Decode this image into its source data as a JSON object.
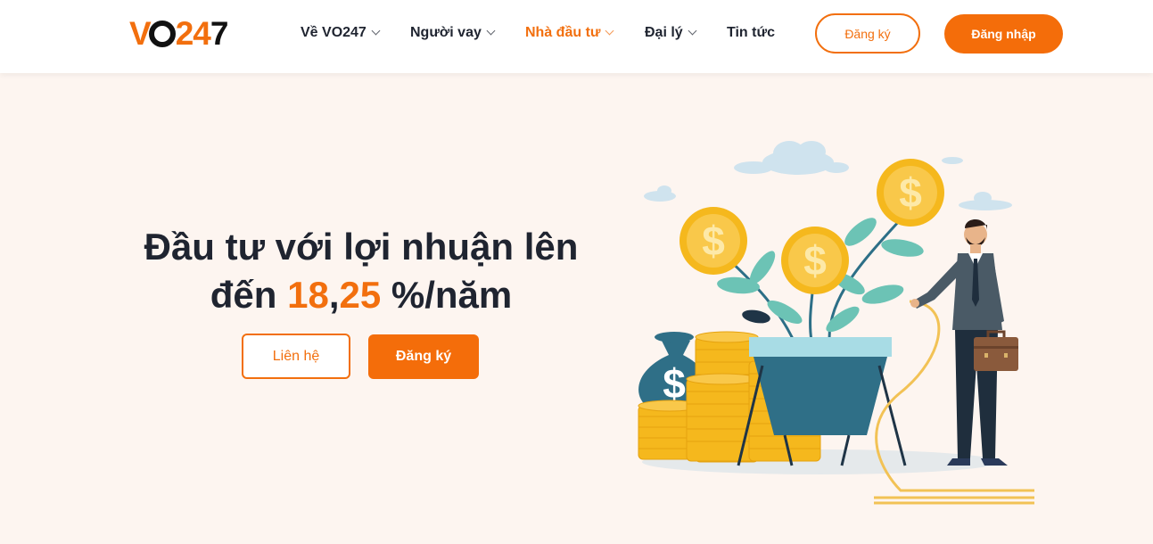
{
  "header": {
    "logo": {
      "v": "V",
      "num": "24",
      "last": "7"
    },
    "nav": [
      {
        "label": "Về VO247",
        "has_dropdown": true,
        "active": false
      },
      {
        "label": "Người vay",
        "has_dropdown": true,
        "active": false
      },
      {
        "label": "Nhà đầu tư",
        "has_dropdown": true,
        "active": true
      },
      {
        "label": "Đại lý",
        "has_dropdown": true,
        "active": false
      },
      {
        "label": "Tin tức",
        "has_dropdown": false,
        "active": false
      }
    ],
    "register_label": "Đăng ký",
    "login_label": "Đăng nhập"
  },
  "hero": {
    "title_line1": "Đầu tư với lợi nhuận lên",
    "title_line2_prefix": "đến ",
    "rate_int": "18",
    "rate_sep": ",",
    "rate_dec": "25",
    "title_line2_suffix": " %/năm",
    "contact_label": "Liên hệ",
    "register_label": "Đăng ký"
  },
  "colors": {
    "accent": "#f26f0e",
    "background": "#fdf5f0",
    "text": "#1f2430",
    "coin": "#f5b81d",
    "teal": "#2f6f87"
  },
  "icons": [
    "chevron-down-icon",
    "dollar-coin-icon",
    "money-bag-icon",
    "briefcase-icon",
    "cloud-icon"
  ]
}
